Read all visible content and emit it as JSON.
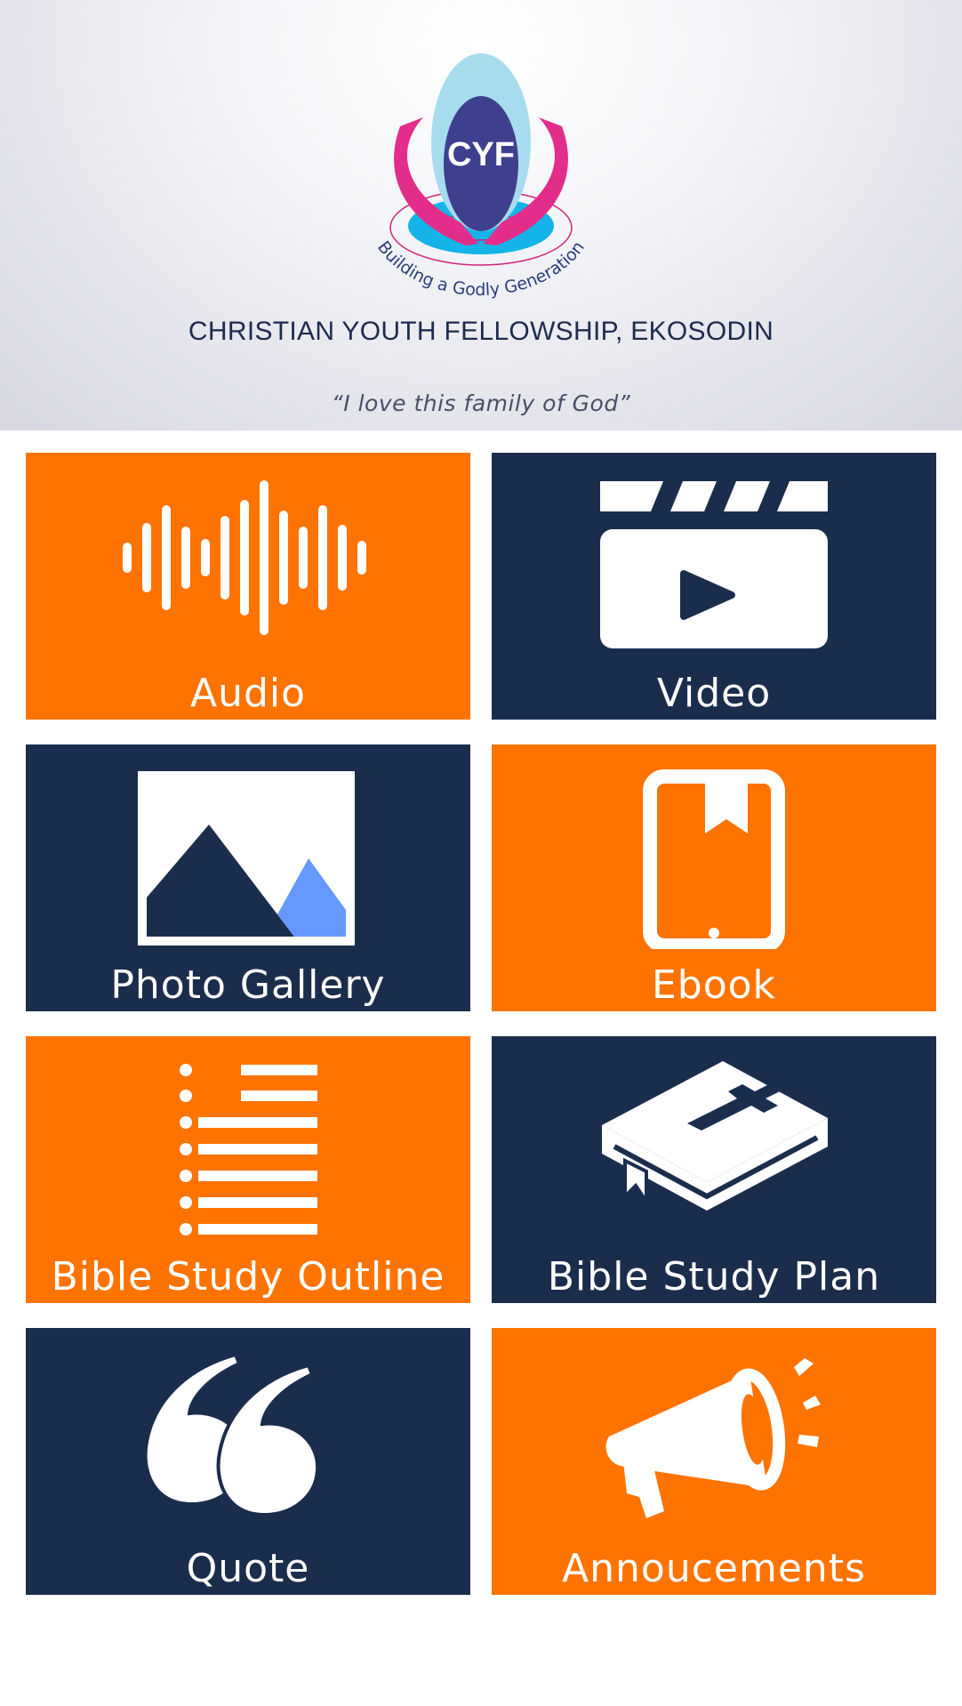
{
  "header": {
    "logo_text": "CYF",
    "logo_motto": "Building a Godly Generation",
    "org_name": "CHRISTIAN YOUTH FELLOWSHIP, EKOSODIN",
    "tagline": "“I love this family of God”"
  },
  "menu": [
    {
      "label": "Audio",
      "icon": "sound-wave-icon",
      "color": "#ff7300"
    },
    {
      "label": "Video",
      "icon": "clapperboard-play-icon",
      "color": "#1b2d4d"
    },
    {
      "label": "Photo Gallery",
      "icon": "mountain-image-icon",
      "color": "#1b2d4d"
    },
    {
      "label": "Ebook",
      "icon": "tablet-bookmark-icon",
      "color": "#ff7300"
    },
    {
      "label": "Bible Study Outline",
      "icon": "bullet-list-icon",
      "color": "#ff7300"
    },
    {
      "label": "Bible Study Plan",
      "icon": "bible-book-icon",
      "color": "#1b2d4d"
    },
    {
      "label": "Quote",
      "icon": "quote-marks-icon",
      "color": "#1b2d4d"
    },
    {
      "label": "Annoucements",
      "icon": "megaphone-icon",
      "color": "#ff7300"
    }
  ]
}
